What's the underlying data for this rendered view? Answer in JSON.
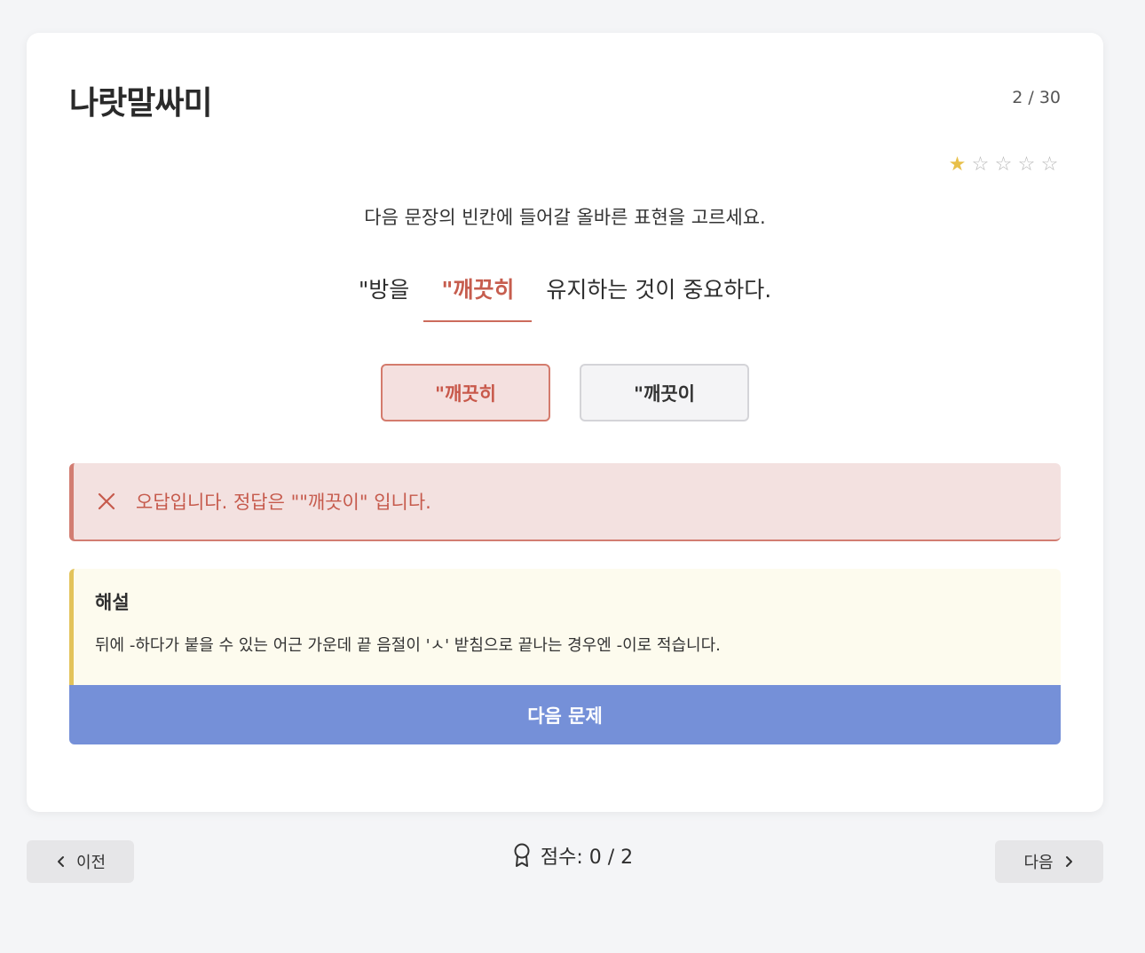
{
  "app": {
    "title": "나랏말싸미",
    "progress": "2 / 30"
  },
  "difficulty": {
    "filled": 1,
    "total": 5,
    "stars": [
      "★",
      "☆",
      "☆",
      "☆",
      "☆"
    ]
  },
  "question": {
    "instruction": "다음 문장의 빈칸에 들어갈 올바른 표현을 고르세요.",
    "before": "\"방을",
    "blank_answer": "\"깨끗히",
    "after": "유지하는 것이 중요하다."
  },
  "options": [
    {
      "label": "\"깨끗히",
      "state": "wrong-selected"
    },
    {
      "label": "\"깨끗이",
      "state": "neutral"
    }
  ],
  "result": {
    "icon": "close-icon",
    "text": "오답입니다. 정답은 \"\"깨끗이\" 입니다."
  },
  "explanation": {
    "title": "해설",
    "body": "뒤에 -하다가 붙을 수 있는 어근 가운데 끝 음절이 'ㅅ' 받침으로 끝나는 경우엔 -이로 적습니다."
  },
  "next_question_label": "다음 문제",
  "nav": {
    "prev_label": "이전",
    "next_label": "다음"
  },
  "score": {
    "text": "점수: 0 / 2",
    "icon": "award-icon"
  },
  "colors": {
    "accent": "#7590d8",
    "error": "#c65a4c",
    "star": "#e8c04a",
    "explain_border": "#e3c35a"
  }
}
